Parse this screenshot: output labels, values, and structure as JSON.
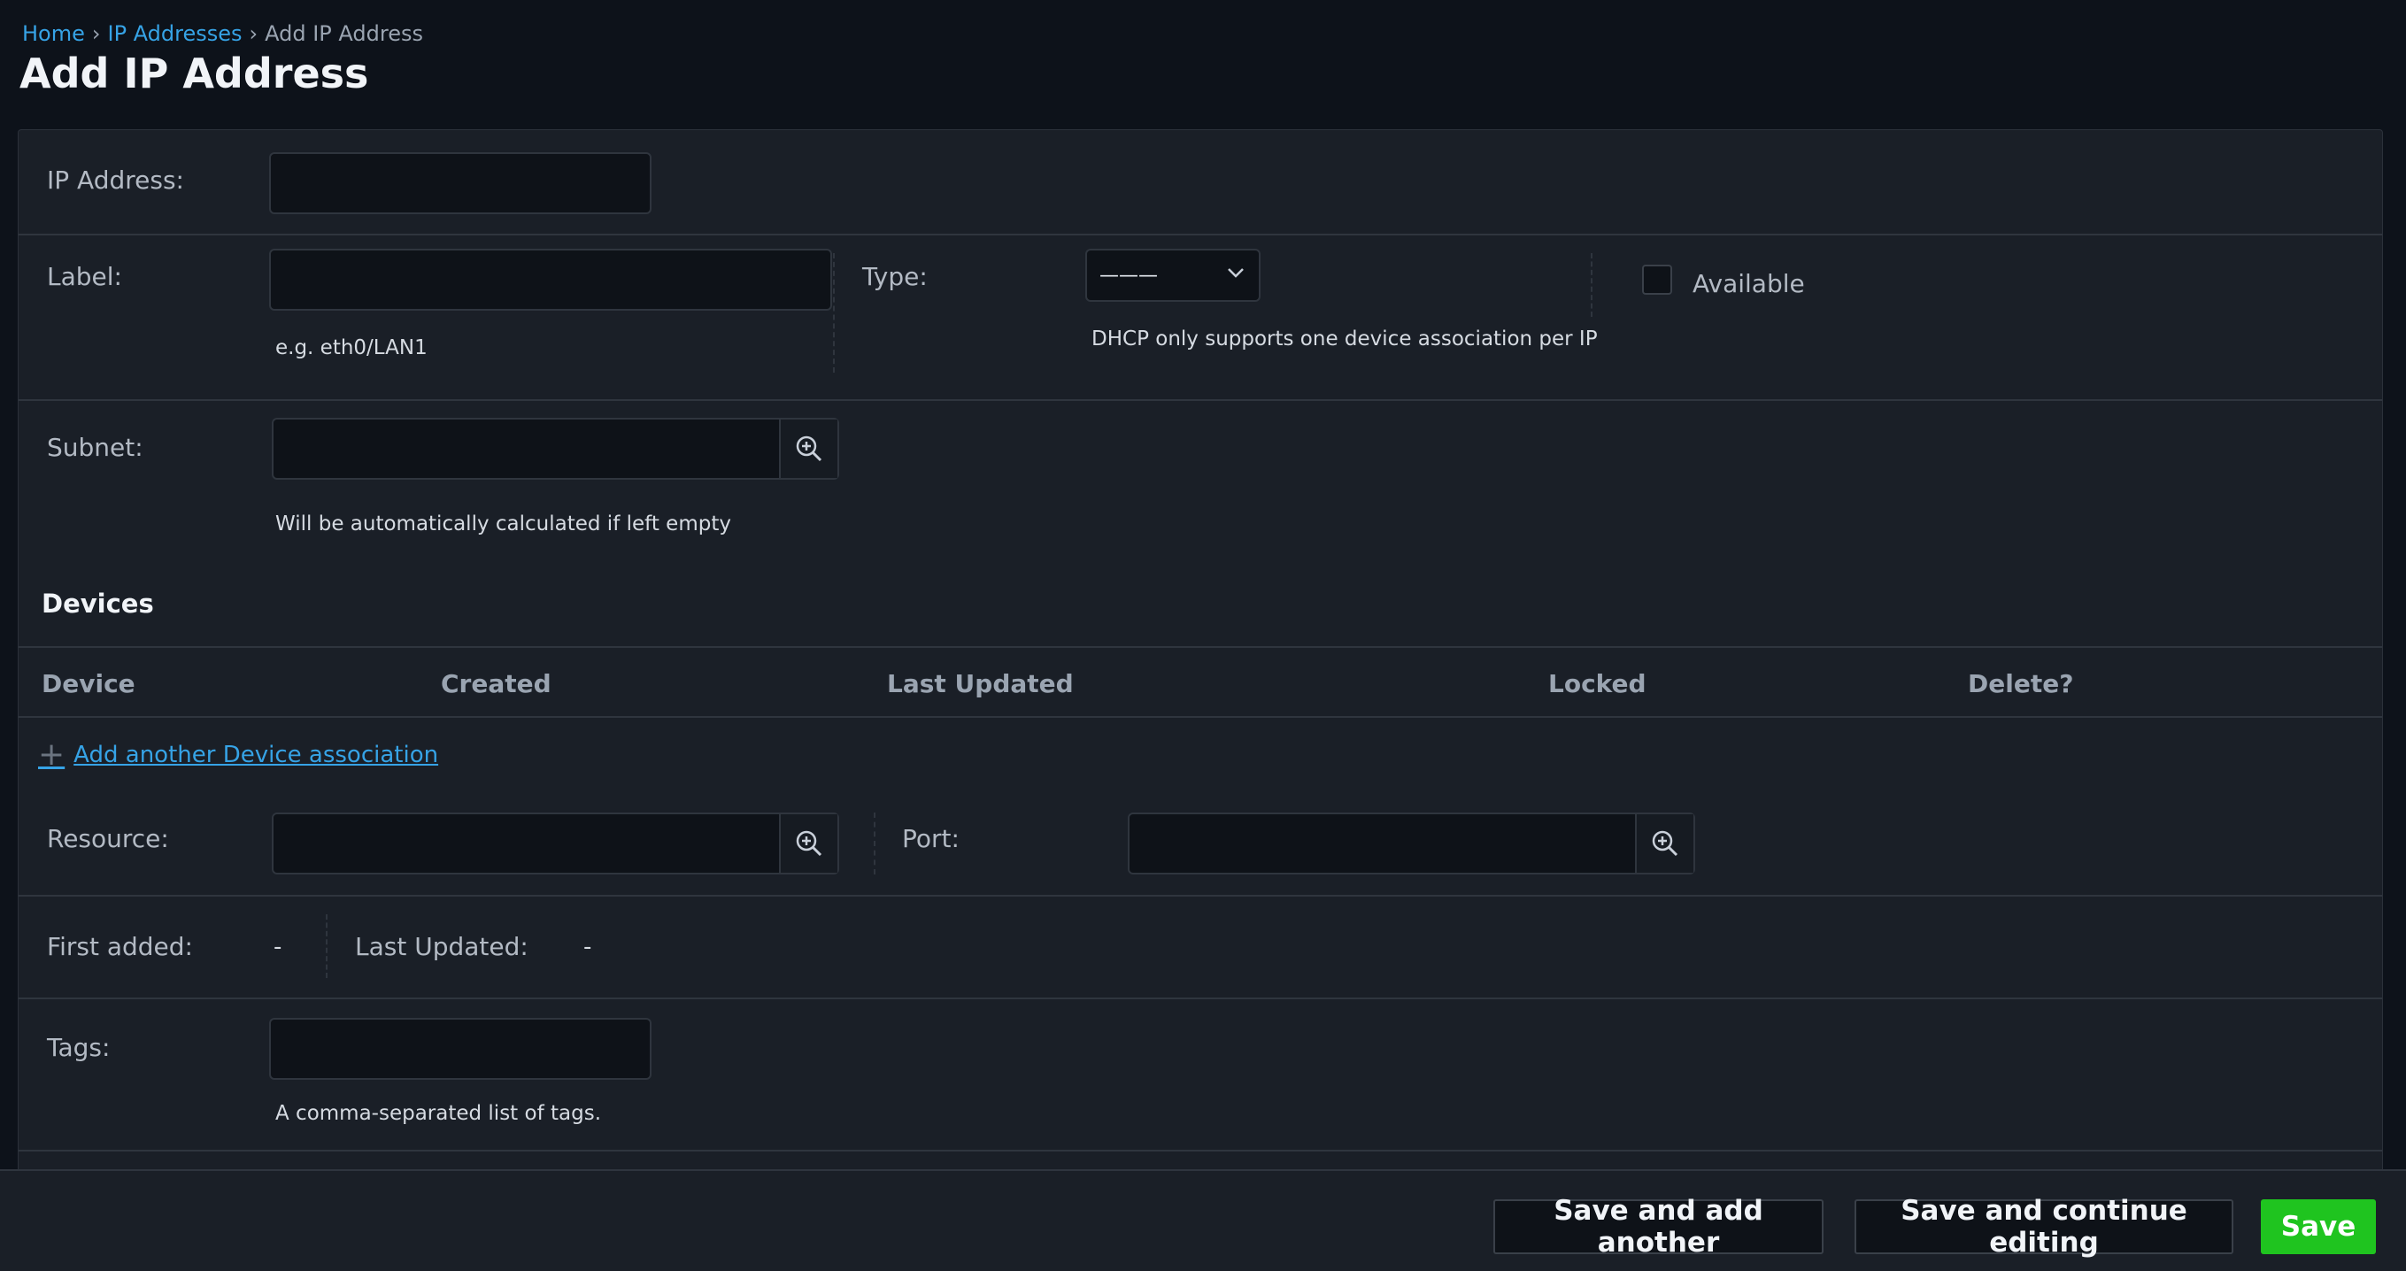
{
  "breadcrumb": {
    "home": "Home",
    "sep1": "›",
    "ip_addresses": "IP Addresses",
    "sep2": "›",
    "current": "Add IP Address"
  },
  "page_title": "Add IP Address",
  "form": {
    "ip_address": {
      "label": "IP Address:",
      "value": ""
    },
    "label": {
      "label": "Label:",
      "value": "",
      "help": "e.g. eth0/LAN1"
    },
    "type": {
      "label": "Type:",
      "selected": "———",
      "help": "DHCP only supports one device association per IP"
    },
    "available": {
      "label": "Available",
      "checked": false
    },
    "subnet": {
      "label": "Subnet:",
      "value": "",
      "help": "Will be automatically calculated if left empty"
    }
  },
  "devices": {
    "title": "Devices",
    "columns": [
      "Device",
      "Created",
      "Last Updated",
      "Locked",
      "Delete?"
    ],
    "add_link": "Add another Device association"
  },
  "resource": {
    "label": "Resource:",
    "value": ""
  },
  "port": {
    "label": "Port:",
    "value": ""
  },
  "first_added": {
    "label": "First added:",
    "value": "-"
  },
  "last_updated": {
    "label": "Last Updated:",
    "value": "-"
  },
  "tags": {
    "label": "Tags:",
    "value": "",
    "help": "A comma-separated list of tags."
  },
  "footer": {
    "save_add_another": "Save and add another",
    "save_continue": "Save and continue editing",
    "save": "Save"
  },
  "colors": {
    "accent_link": "#36a3e6",
    "save_green": "#1fc41f",
    "panel_bg": "#1a1f27",
    "page_bg": "#0d121a"
  },
  "icons": {
    "lookup": "magnifier-plus-icon",
    "select_arrow": "chevron-down-icon",
    "add": "plus-icon"
  }
}
